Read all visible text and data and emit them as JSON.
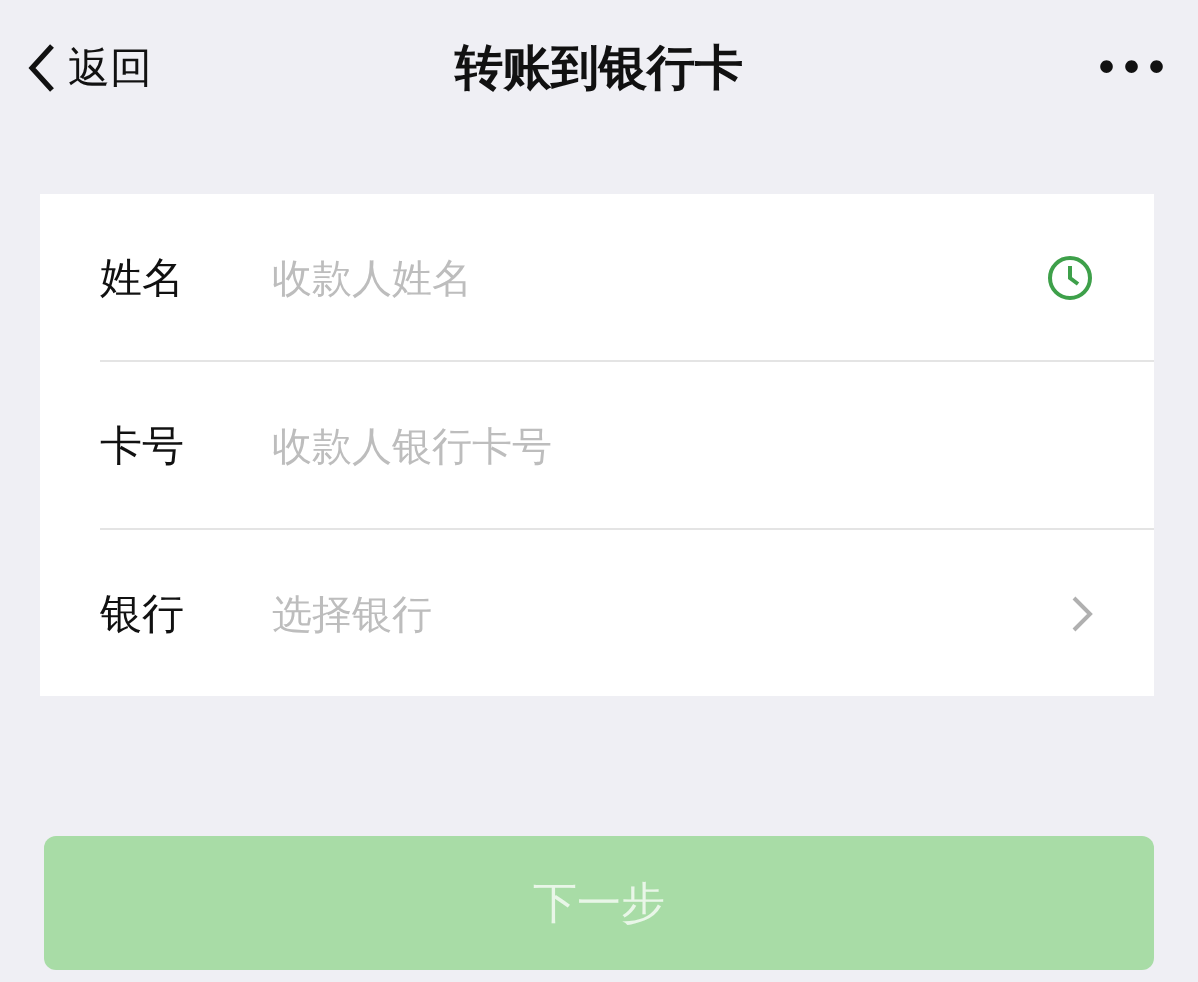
{
  "nav": {
    "back": "返回",
    "title": "转账到银行卡",
    "more": "•••"
  },
  "form": [
    {
      "label": "姓名",
      "placeholder": "收款人姓名",
      "kind": "clock"
    },
    {
      "label": "卡号",
      "placeholder": "收款人银行卡号",
      "kind": "plain"
    },
    {
      "label": "银行",
      "placeholder": "选择银行",
      "kind": "chevron"
    }
  ],
  "next_button": {
    "label": "下一步",
    "disabled": true
  }
}
